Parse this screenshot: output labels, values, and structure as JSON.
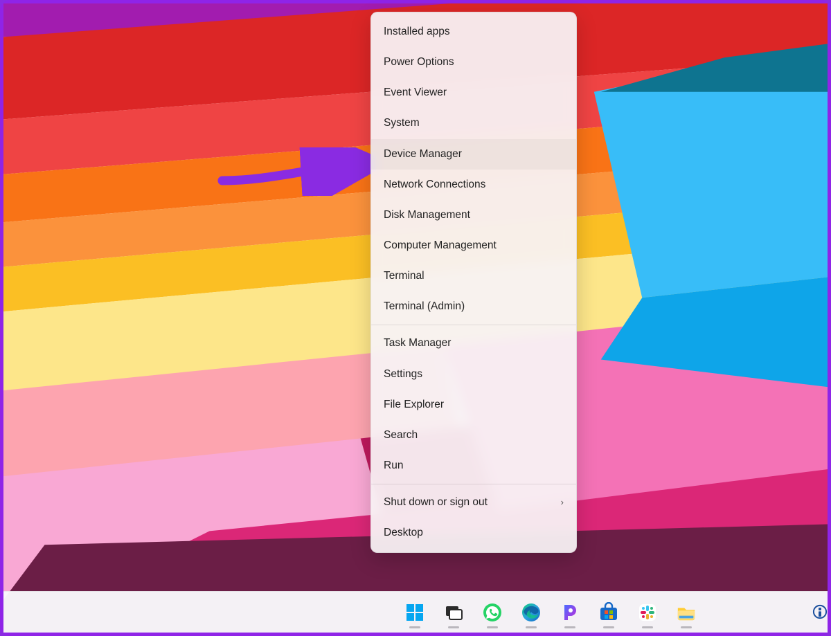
{
  "menu": {
    "groups": [
      [
        {
          "label": "Installed apps",
          "name": "menu-installed-apps"
        },
        {
          "label": "Power Options",
          "name": "menu-power-options"
        },
        {
          "label": "Event Viewer",
          "name": "menu-event-viewer"
        },
        {
          "label": "System",
          "name": "menu-system"
        },
        {
          "label": "Device Manager",
          "name": "menu-device-manager",
          "highlighted": true
        },
        {
          "label": "Network Connections",
          "name": "menu-network-connections"
        },
        {
          "label": "Disk Management",
          "name": "menu-disk-management"
        },
        {
          "label": "Computer Management",
          "name": "menu-computer-management"
        },
        {
          "label": "Terminal",
          "name": "menu-terminal"
        },
        {
          "label": "Terminal (Admin)",
          "name": "menu-terminal-admin"
        }
      ],
      [
        {
          "label": "Task Manager",
          "name": "menu-task-manager"
        },
        {
          "label": "Settings",
          "name": "menu-settings"
        },
        {
          "label": "File Explorer",
          "name": "menu-file-explorer"
        },
        {
          "label": "Search",
          "name": "menu-search"
        },
        {
          "label": "Run",
          "name": "menu-run"
        }
      ],
      [
        {
          "label": "Shut down or sign out",
          "name": "menu-shutdown",
          "submenu": true
        },
        {
          "label": "Desktop",
          "name": "menu-desktop"
        }
      ]
    ]
  },
  "taskbar": {
    "items": [
      {
        "name": "start-button",
        "icon": "windows-icon"
      },
      {
        "name": "task-view-button",
        "icon": "taskview-icon"
      },
      {
        "name": "whatsapp-button",
        "icon": "whatsapp-icon"
      },
      {
        "name": "edge-button",
        "icon": "edge-icon"
      },
      {
        "name": "app-p-button",
        "icon": "p-icon"
      },
      {
        "name": "microsoft-store-button",
        "icon": "store-icon"
      },
      {
        "name": "slack-button",
        "icon": "slack-icon"
      },
      {
        "name": "file-explorer-button",
        "icon": "explorer-icon"
      }
    ]
  },
  "annotation": {
    "color": "#8a2be2",
    "target": "Device Manager"
  }
}
